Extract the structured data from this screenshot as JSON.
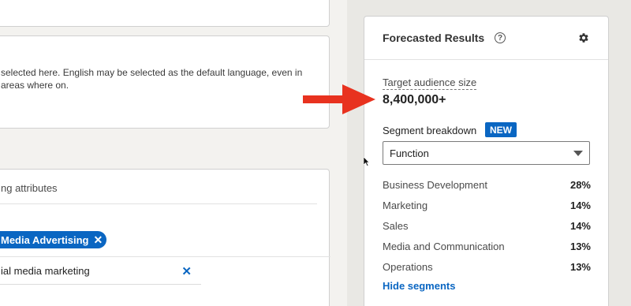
{
  "left": {
    "language_text": "selected here. English may be selected as the default language, even in areas where on.",
    "attributes_header": "ng attributes",
    "selected_pill": "Media Advertising",
    "typed_value": "ial media marketing"
  },
  "forecast": {
    "title": "Forecasted Results",
    "target_audience_label": "Target audience size",
    "target_audience_value": "8,400,000+",
    "segment_label": "Segment breakdown",
    "new_badge": "NEW",
    "select_value": "Function",
    "segments": [
      {
        "name": "Business Development",
        "pct": "28%"
      },
      {
        "name": "Marketing",
        "pct": "14%"
      },
      {
        "name": "Sales",
        "pct": "14%"
      },
      {
        "name": "Media and Communication",
        "pct": "13%"
      },
      {
        "name": "Operations",
        "pct": "13%"
      }
    ],
    "hide_link": "Hide segments"
  },
  "icons": {
    "help": "help-circle-icon",
    "settings": "gear-icon",
    "remove": "close-icon",
    "dropdown": "chevron-down-icon",
    "annotation": "red-arrow-icon",
    "pointer": "mouse-cursor-icon"
  },
  "colors": {
    "accent": "#0a66c2",
    "arrow": "#e8321f"
  }
}
